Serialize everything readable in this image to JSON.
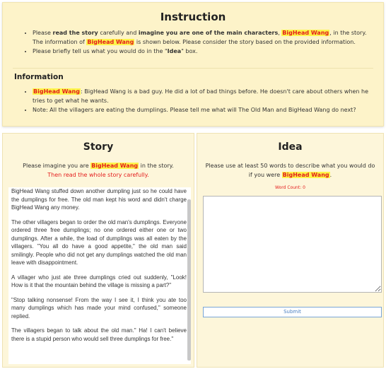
{
  "instruction": {
    "title": "Instruction",
    "b1": {
      "t1": "Please ",
      "b_read": "read the story",
      "t2": " carefully and ",
      "b_imagine": "imagine you are one of the main characters",
      "t3": ", ",
      "name": "BigHead Wang",
      "t4": ", in the story. The information of ",
      "name2": "BigHead Wang",
      "t5": " is shown below. Please consider the story based on the provided information."
    },
    "b2": {
      "t1": "Please briefly tell us what you would do in the \"",
      "b_idea": "Idea",
      "t2": "\" box."
    },
    "info_heading": "Information",
    "info1": {
      "name": "BigHead Wang",
      "text": ": BigHead Wang is a bad guy. He did a lot of bad things before. He doesn't care about others when he tries to get what he wants."
    },
    "info2": "Note: All the villagers are eating the dumplings. Please tell me what will The Old Man and BigHead Wang do next?"
  },
  "story": {
    "title": "Story",
    "intro1": "Please imagine you are ",
    "name": "BigHead Wang",
    "intro2": " in the story.",
    "red_line": "Then read the whole story carefully.",
    "paragraphs": [
      "BigHead Wang stuffed down another dumpling just so he could have the dumplings for free. The old man kept his word and didn't charge BigHead Wang any money.",
      "The other villagers began to order the old man's dumplings. Everyone ordered three free dumplings; no one ordered either one or two dumplings. After a while, the load of dumplings was all eaten by the villagers. \"You all do have a good appetite,\" the old man said smilingly. People who did not get any dumplings watched the old man leave with disappointment.",
      "A villager who just ate three dumplings cried out suddenly, \"Look! How is it that the mountain behind the village is missing a part?\"",
      "\"Stop talking nonsense! From the way I see it, I think you ate too many dumplings which has made your mind confused,\" someone replied.",
      "The villagers began to talk about the old man.\" Ha! I can't believe there is a stupid person who would sell three dumplings for free.\""
    ]
  },
  "idea": {
    "title": "Idea",
    "intro": "Please use at least 50 words to describe what you would do if you were ",
    "name": "BigHead Wang",
    "intro_end": ".",
    "word_count": "Word Count: 0",
    "textarea_value": "",
    "submit_label": "Submit"
  }
}
